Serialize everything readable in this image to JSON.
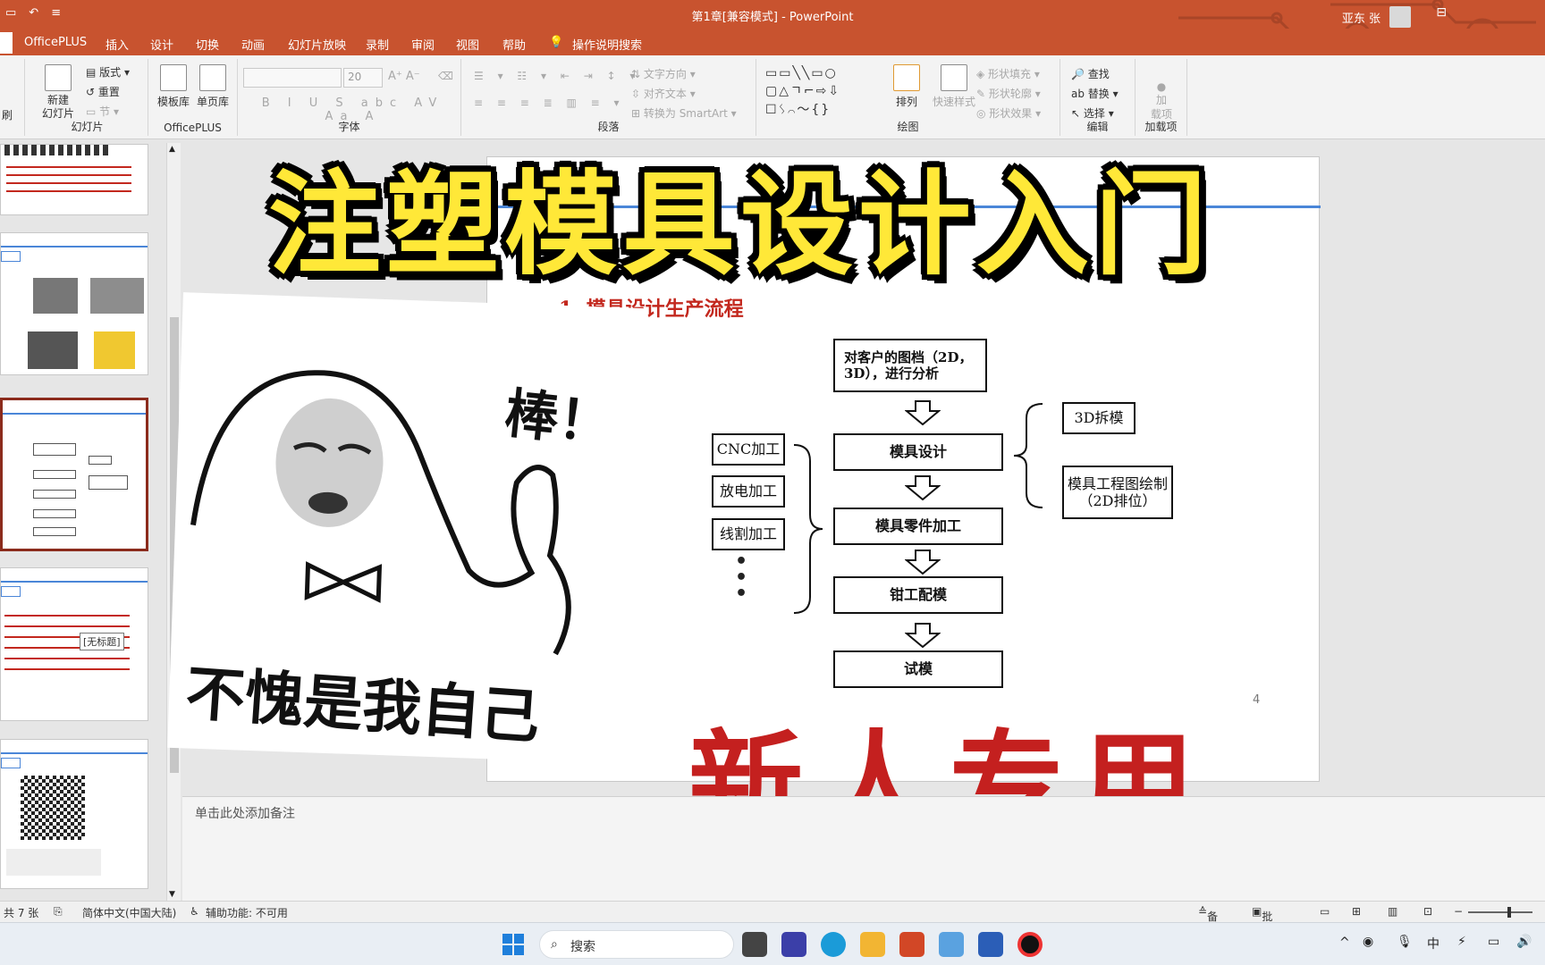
{
  "titlebar": {
    "document_title": "第1章[兼容模式]  -  PowerPoint",
    "user_name": "亚东 张",
    "accent": "#c8532f"
  },
  "menu": {
    "tabs": [
      "OfficePLUS",
      "插入",
      "设计",
      "切换",
      "动画",
      "幻灯片放映",
      "录制",
      "审阅",
      "视图",
      "帮助"
    ],
    "search_label": "操作说明搜索"
  },
  "ribbon": {
    "slides_group": {
      "label": "幻灯片",
      "new_slide": "新建\n幻灯片",
      "layout": "版式",
      "reset": "重置",
      "section": "节"
    },
    "officeplus_group": {
      "label": "OfficePLUS",
      "template_lib": "模板库",
      "single_page_lib": "单页库"
    },
    "font_group": {
      "label": "字体",
      "font_size": "20"
    },
    "paragraph_group": {
      "label": "段落",
      "text_direction": "文字方向",
      "align_text": "对齐文本",
      "convert_smartart": "转换为 SmartArt"
    },
    "drawing_group": {
      "label": "绘图",
      "arrange": "排列",
      "quick_styles": "快速样式",
      "shape_fill": "形状填充",
      "shape_outline": "形状轮廓",
      "shape_effects": "形状效果"
    },
    "editing_group": {
      "label": "编辑",
      "find": "查找",
      "replace": "替换",
      "select": "选择"
    },
    "addins_group": {
      "label": "加载项",
      "addins": "加\n载项"
    },
    "left_cut": "刷"
  },
  "thumbnails": {
    "tooltip": "[无标题]"
  },
  "slide": {
    "heading": "1. 模具设计生产流程",
    "page_number": "4",
    "flow": [
      "对客户的图档（2D，3D），进行分析",
      "模具设计",
      "模具零件加工",
      "钳工配模",
      "试模"
    ],
    "left_processes": [
      "CNC加工",
      "放电加工",
      "线割加工"
    ],
    "right_items": [
      "3D拆模",
      "模具工程图绘制（2D排位）"
    ]
  },
  "overlay": {
    "big_title": "注塑模具设计入门",
    "red_title": "新人专用",
    "meme_exclaim": "棒！",
    "meme_caption": "不愧是我自己"
  },
  "notes": {
    "placeholder": "单击此处添加备注"
  },
  "status": {
    "slide_count": "共 7 张",
    "language": "简体中文(中国大陆)",
    "accessibility": "辅助功能: 不可用",
    "notes_btn": "备注",
    "comments_btn": "批注"
  },
  "taskbar": {
    "search_placeholder": "搜索"
  }
}
